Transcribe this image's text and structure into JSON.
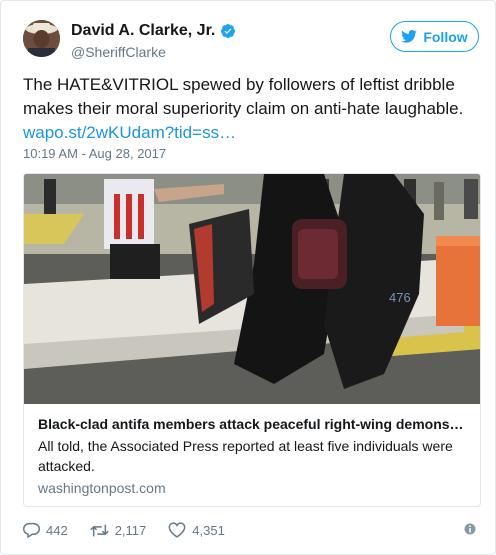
{
  "author": {
    "name": "David A. Clarke, Jr.",
    "handle": "@SheriffClarke"
  },
  "follow_label": "Follow",
  "tweet": {
    "text": "The HATE&VITRIOL spewed by followers of leftist dribble makes their moral superiority claim on anti-hate laughable.",
    "link": "wapo.st/2wKUdam?tid=ss…",
    "timestamp": "10:19 AM - Aug 28, 2017"
  },
  "card": {
    "title": "Black-clad antifa members attack peaceful right-wing demons…",
    "description": "All told, the Associated Press reported at least five individuals were attacked.",
    "domain": "washingtonpost.com"
  },
  "actions": {
    "replies": "442",
    "retweets": "2,117",
    "likes": "4,351"
  },
  "colors": {
    "accent": "#1da1f2",
    "link": "#1b95e0",
    "muted": "#657786"
  }
}
